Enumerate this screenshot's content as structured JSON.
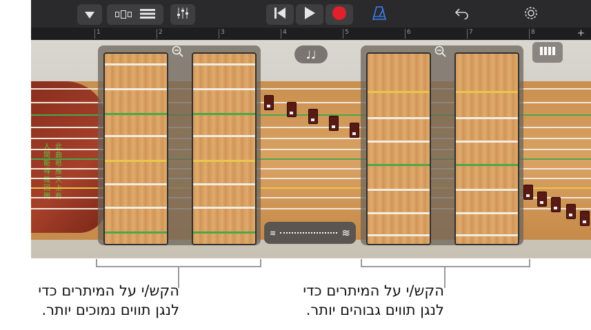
{
  "toolbar": {
    "browser_icon": "dropdown-triangle-icon",
    "view_icon": "tracks-view-icon",
    "list_icon": "list-view-icon",
    "mixer_icon": "mixer-sliders-icon",
    "rewind_icon": "go-to-start-icon",
    "play_icon": "play-icon",
    "record_icon": "record-icon",
    "metronome_icon": "metronome-icon",
    "undo_icon": "undo-icon",
    "settings_icon": "settings-gear-icon",
    "record_color": "#e0202a",
    "metronome_color": "#3b82f6"
  },
  "ruler": {
    "marks": [
      "1",
      "2",
      "3",
      "4",
      "5",
      "6",
      "7",
      "8"
    ],
    "add_label": "+"
  },
  "instrument": {
    "poem_col1": "此曲衹應天上有",
    "poem_col2": "人間能得幾回聞",
    "notes_button_label": "♩♩",
    "glide_left": "≋",
    "glide_right": "≋"
  },
  "annotations": {
    "left_callout_line1": "הקש/י על המיתרים כדי",
    "left_callout_line2": "לנגן תווים נמוכים יותר.",
    "right_callout_line1": "הקש/י על המיתרים כדי",
    "right_callout_line2": "לנגן תווים גבוהים יותר."
  }
}
